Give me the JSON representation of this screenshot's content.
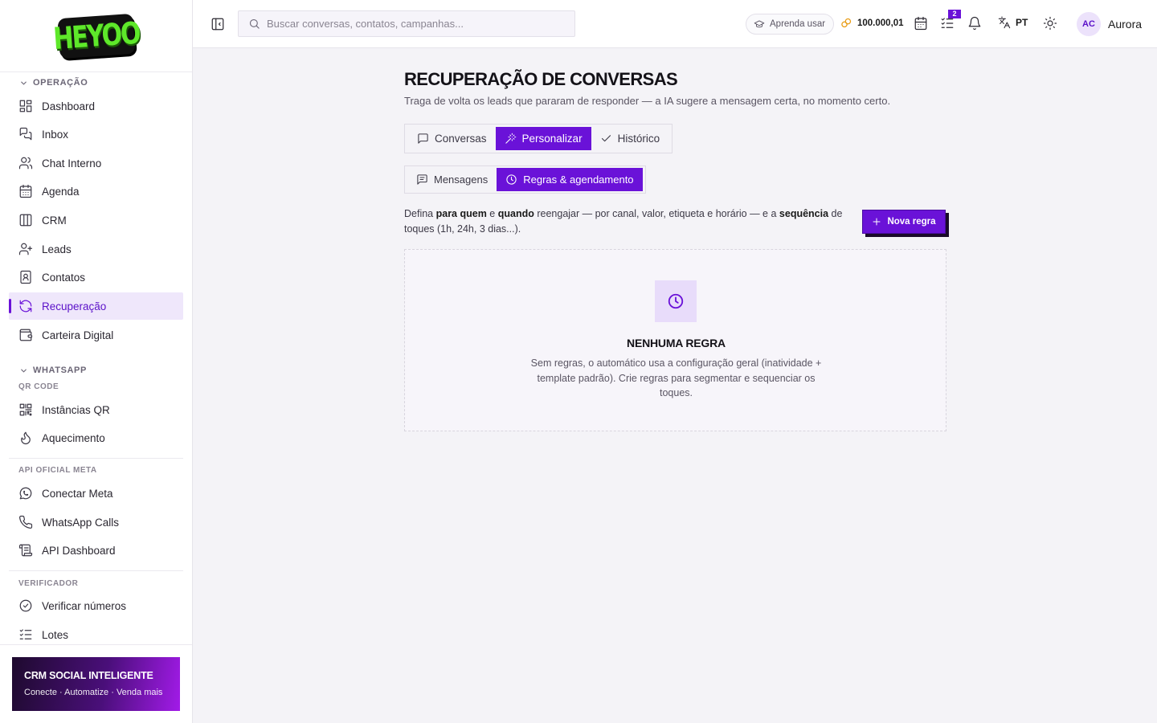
{
  "brand": {
    "logo_text": "HEYOO"
  },
  "sidebar": {
    "sections": [
      {
        "title": "Operação"
      },
      {
        "title": "WhatsApp",
        "subtitle": "QR Code"
      },
      {
        "subtitle": "API Oficial Meta"
      },
      {
        "subtitle": "Verificador"
      }
    ],
    "items": [
      {
        "label": "Dashboard"
      },
      {
        "label": "Inbox"
      },
      {
        "label": "Chat Interno"
      },
      {
        "label": "Agenda"
      },
      {
        "label": "CRM"
      },
      {
        "label": "Leads"
      },
      {
        "label": "Contatos"
      },
      {
        "label": "Recuperação",
        "active": true
      },
      {
        "label": "Carteira Digital"
      },
      {
        "label": "Instâncias QR"
      },
      {
        "label": "Aquecimento"
      },
      {
        "label": "Conectar Meta"
      },
      {
        "label": "WhatsApp Calls"
      },
      {
        "label": "API Dashboard"
      },
      {
        "label": "Verificar números"
      },
      {
        "label": "Lotes"
      }
    ],
    "promo": {
      "title": "CRM SOCIAL INTELIGENTE",
      "subtitle": "Conecte · Automatize · Venda mais"
    }
  },
  "topbar": {
    "search_placeholder": "Buscar conversas, contatos, campanhas...",
    "learn_label": "Aprenda usar",
    "credits": "100.000,01",
    "tasks_badge": "2",
    "language": "PT",
    "user": {
      "initials": "AC",
      "name": "Aurora"
    }
  },
  "page": {
    "title": "RECUPERAÇÃO DE CONVERSAS",
    "subtitle": "Traga de volta os leads que pararam de responder — a IA sugere a mensagem certa, no momento certo.",
    "tabs": [
      {
        "label": "Conversas",
        "icon": "message-square-icon"
      },
      {
        "label": "Personalizar",
        "icon": "magic-wand-icon",
        "active": true
      },
      {
        "label": "Histórico",
        "icon": "check-icon"
      }
    ],
    "subtabs": [
      {
        "label": "Mensagens",
        "icon": "message-lines-icon"
      },
      {
        "label": "Regras & agendamento",
        "icon": "clock-icon",
        "active": true
      }
    ],
    "description": {
      "p1": "Defina ",
      "b1": "para quem",
      "p2": " e ",
      "b2": "quando",
      "p3": " reengajar — por canal, valor, etiqueta e horário — e a ",
      "b3": "sequência",
      "p4": " de toques (1h, 24h, 3 dias...)."
    },
    "new_rule_label": "Nova regra",
    "empty": {
      "title": "NENHUMA REGRA",
      "text": "Sem regras, o automático usa a configuração geral (inatividade + template padrão). Crie regras para segmentar e sequenciar os toques."
    }
  },
  "colors": {
    "accent": "#6a12d8",
    "accent_soft": "#efe7fb",
    "logo_green": "#5ee82a"
  }
}
